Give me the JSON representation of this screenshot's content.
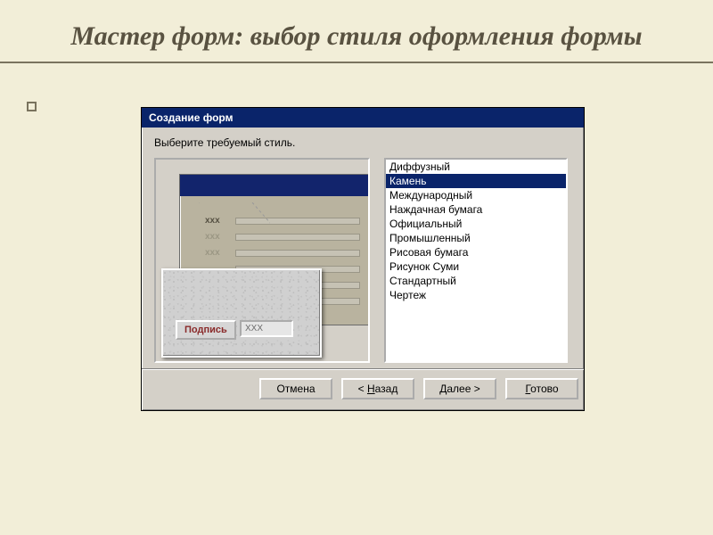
{
  "slide": {
    "title": "Мастер форм: выбор стиля оформления формы"
  },
  "window": {
    "title": "Создание форм",
    "prompt": "Выберите требуемый стиль."
  },
  "preview": {
    "row_label1": "xxx",
    "row_label2": "xxx",
    "row_label3": "xxx",
    "caption_label": "Подпись",
    "caption_value": "XXX"
  },
  "styles": {
    "items": [
      "Диффузный",
      "Камень",
      "Международный",
      "Наждачная бумага",
      "Официальный",
      "Промышленный",
      "Рисовая бумага",
      "Рисунок Суми",
      "Стандартный",
      "Чертеж"
    ],
    "selected_index": 1
  },
  "buttons": {
    "cancel": "Отмена",
    "back_prefix": "< ",
    "back_hot": "Н",
    "back_rest": "азад",
    "next_hot": "Д",
    "next_rest": "алее >",
    "finish_hot": "Г",
    "finish_rest": "отово"
  }
}
